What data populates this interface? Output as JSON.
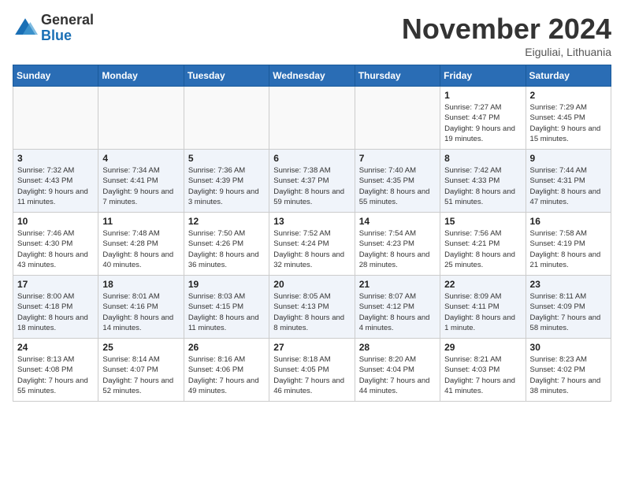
{
  "logo": {
    "general": "General",
    "blue": "Blue"
  },
  "title": "November 2024",
  "location": "Eiguliai, Lithuania",
  "weekdays": [
    "Sunday",
    "Monday",
    "Tuesday",
    "Wednesday",
    "Thursday",
    "Friday",
    "Saturday"
  ],
  "weeks": [
    [
      {
        "day": "",
        "info": ""
      },
      {
        "day": "",
        "info": ""
      },
      {
        "day": "",
        "info": ""
      },
      {
        "day": "",
        "info": ""
      },
      {
        "day": "",
        "info": ""
      },
      {
        "day": "1",
        "info": "Sunrise: 7:27 AM\nSunset: 4:47 PM\nDaylight: 9 hours and 19 minutes."
      },
      {
        "day": "2",
        "info": "Sunrise: 7:29 AM\nSunset: 4:45 PM\nDaylight: 9 hours and 15 minutes."
      }
    ],
    [
      {
        "day": "3",
        "info": "Sunrise: 7:32 AM\nSunset: 4:43 PM\nDaylight: 9 hours and 11 minutes."
      },
      {
        "day": "4",
        "info": "Sunrise: 7:34 AM\nSunset: 4:41 PM\nDaylight: 9 hours and 7 minutes."
      },
      {
        "day": "5",
        "info": "Sunrise: 7:36 AM\nSunset: 4:39 PM\nDaylight: 9 hours and 3 minutes."
      },
      {
        "day": "6",
        "info": "Sunrise: 7:38 AM\nSunset: 4:37 PM\nDaylight: 8 hours and 59 minutes."
      },
      {
        "day": "7",
        "info": "Sunrise: 7:40 AM\nSunset: 4:35 PM\nDaylight: 8 hours and 55 minutes."
      },
      {
        "day": "8",
        "info": "Sunrise: 7:42 AM\nSunset: 4:33 PM\nDaylight: 8 hours and 51 minutes."
      },
      {
        "day": "9",
        "info": "Sunrise: 7:44 AM\nSunset: 4:31 PM\nDaylight: 8 hours and 47 minutes."
      }
    ],
    [
      {
        "day": "10",
        "info": "Sunrise: 7:46 AM\nSunset: 4:30 PM\nDaylight: 8 hours and 43 minutes."
      },
      {
        "day": "11",
        "info": "Sunrise: 7:48 AM\nSunset: 4:28 PM\nDaylight: 8 hours and 40 minutes."
      },
      {
        "day": "12",
        "info": "Sunrise: 7:50 AM\nSunset: 4:26 PM\nDaylight: 8 hours and 36 minutes."
      },
      {
        "day": "13",
        "info": "Sunrise: 7:52 AM\nSunset: 4:24 PM\nDaylight: 8 hours and 32 minutes."
      },
      {
        "day": "14",
        "info": "Sunrise: 7:54 AM\nSunset: 4:23 PM\nDaylight: 8 hours and 28 minutes."
      },
      {
        "day": "15",
        "info": "Sunrise: 7:56 AM\nSunset: 4:21 PM\nDaylight: 8 hours and 25 minutes."
      },
      {
        "day": "16",
        "info": "Sunrise: 7:58 AM\nSunset: 4:19 PM\nDaylight: 8 hours and 21 minutes."
      }
    ],
    [
      {
        "day": "17",
        "info": "Sunrise: 8:00 AM\nSunset: 4:18 PM\nDaylight: 8 hours and 18 minutes."
      },
      {
        "day": "18",
        "info": "Sunrise: 8:01 AM\nSunset: 4:16 PM\nDaylight: 8 hours and 14 minutes."
      },
      {
        "day": "19",
        "info": "Sunrise: 8:03 AM\nSunset: 4:15 PM\nDaylight: 8 hours and 11 minutes."
      },
      {
        "day": "20",
        "info": "Sunrise: 8:05 AM\nSunset: 4:13 PM\nDaylight: 8 hours and 8 minutes."
      },
      {
        "day": "21",
        "info": "Sunrise: 8:07 AM\nSunset: 4:12 PM\nDaylight: 8 hours and 4 minutes."
      },
      {
        "day": "22",
        "info": "Sunrise: 8:09 AM\nSunset: 4:11 PM\nDaylight: 8 hours and 1 minute."
      },
      {
        "day": "23",
        "info": "Sunrise: 8:11 AM\nSunset: 4:09 PM\nDaylight: 7 hours and 58 minutes."
      }
    ],
    [
      {
        "day": "24",
        "info": "Sunrise: 8:13 AM\nSunset: 4:08 PM\nDaylight: 7 hours and 55 minutes."
      },
      {
        "day": "25",
        "info": "Sunrise: 8:14 AM\nSunset: 4:07 PM\nDaylight: 7 hours and 52 minutes."
      },
      {
        "day": "26",
        "info": "Sunrise: 8:16 AM\nSunset: 4:06 PM\nDaylight: 7 hours and 49 minutes."
      },
      {
        "day": "27",
        "info": "Sunrise: 8:18 AM\nSunset: 4:05 PM\nDaylight: 7 hours and 46 minutes."
      },
      {
        "day": "28",
        "info": "Sunrise: 8:20 AM\nSunset: 4:04 PM\nDaylight: 7 hours and 44 minutes."
      },
      {
        "day": "29",
        "info": "Sunrise: 8:21 AM\nSunset: 4:03 PM\nDaylight: 7 hours and 41 minutes."
      },
      {
        "day": "30",
        "info": "Sunrise: 8:23 AM\nSunset: 4:02 PM\nDaylight: 7 hours and 38 minutes."
      }
    ]
  ]
}
